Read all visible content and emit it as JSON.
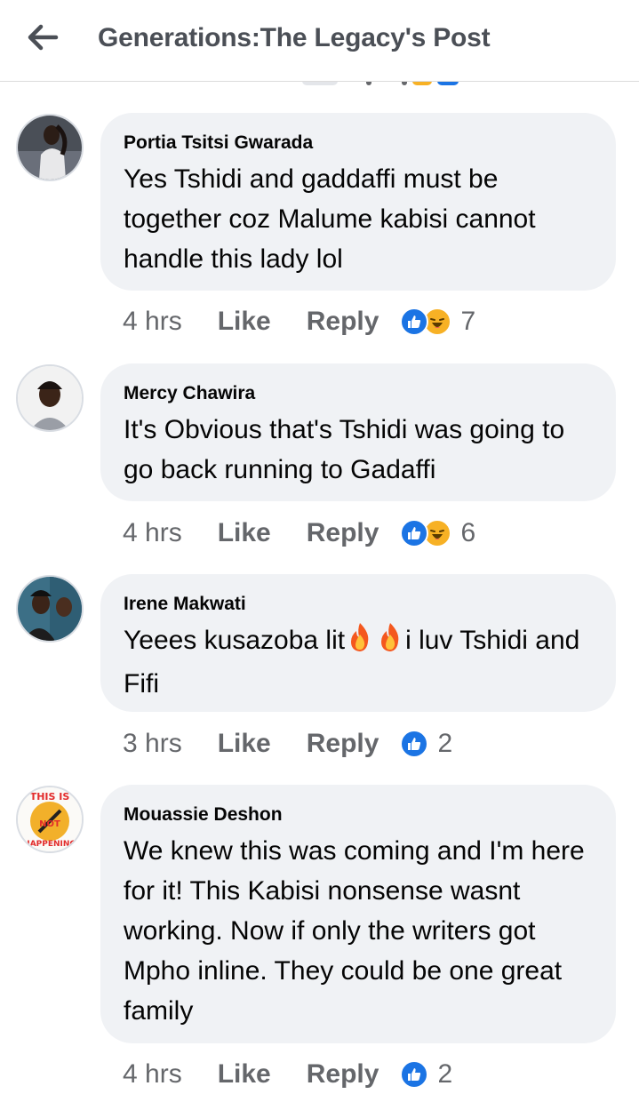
{
  "header": {
    "title": "Generations:The Legacy's Post"
  },
  "colors": {
    "bubble": "#f0f2f5",
    "muted": "#65676b",
    "like_blue": "#1b74e4",
    "haha_yellow": "#f7b125"
  },
  "comments": [
    {
      "author": "Portia Tsitsi Gwarada",
      "text": "Yes Tshidi and gaddaffi must be together coz Malume kabisi cannot handle this lady lol",
      "time": "4 hrs",
      "like": "Like",
      "reply": "Reply",
      "reactions": [
        "like-icon",
        "haha-icon"
      ],
      "reaction_count": "7"
    },
    {
      "author": "Mercy Chawira",
      "text": "It's Obvious that's Tshidi was going to go back running to Gadaffi",
      "time": "4 hrs",
      "like": "Like",
      "reply": "Reply",
      "reactions": [
        "like-icon",
        "haha-icon"
      ],
      "reaction_count": "6"
    },
    {
      "author": "Irene Makwati",
      "text_before": "Yeees kusazoba lit",
      "text_after": "i luv Tshidi and Fifi",
      "emoji": [
        "fire-icon",
        "fire-icon"
      ],
      "time": "3 hrs",
      "like": "Like",
      "reply": "Reply",
      "reactions": [
        "like-icon"
      ],
      "reaction_count": "2"
    },
    {
      "author": "Mouassie Deshon",
      "text": "We knew this was coming and I'm here for it! This Kabisi nonsense wasnt working. Now if only the writers got Mpho inline. They could be one great family",
      "time": "4 hrs",
      "like": "Like",
      "reply": "Reply",
      "reactions": [
        "like-icon"
      ],
      "reaction_count": "2",
      "avatar_text": "THIS IS NOT HAPPENING"
    }
  ]
}
